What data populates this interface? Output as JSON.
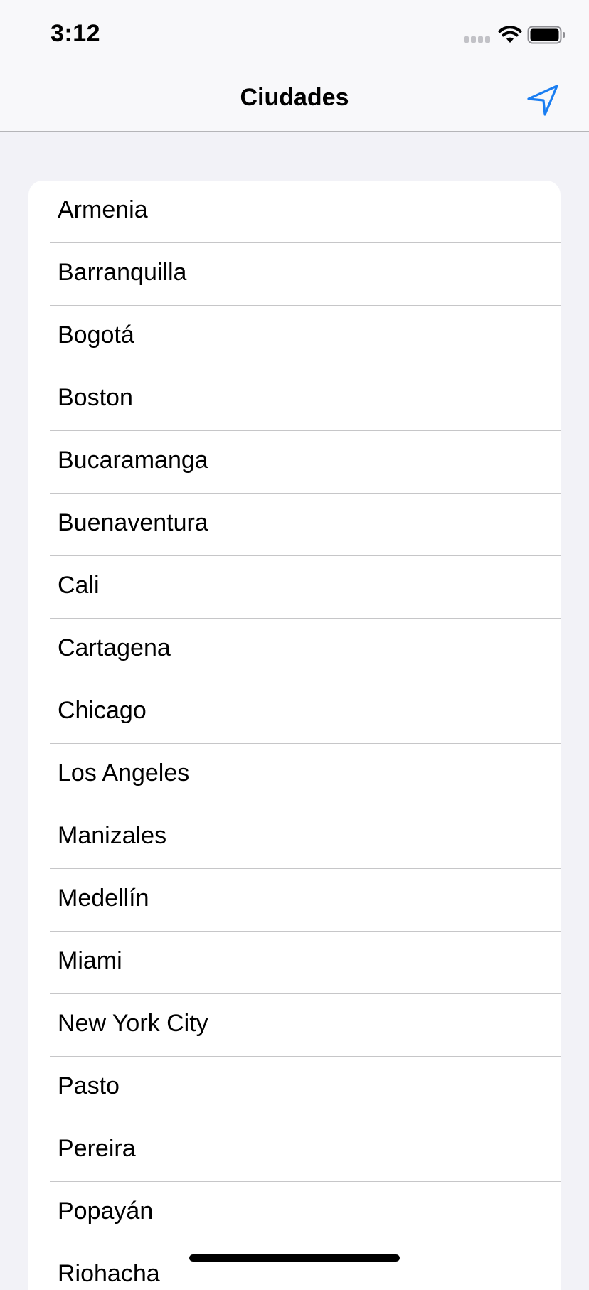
{
  "status_bar": {
    "time": "3:12",
    "signal_icon": "cellular-signal-icon",
    "wifi_icon": "wifi-icon",
    "battery_icon": "battery-icon"
  },
  "nav_bar": {
    "title": "Ciudades",
    "location_icon": "location-arrow-icon",
    "accent_color": "#1a7ef2"
  },
  "cities": [
    "Armenia",
    "Barranquilla",
    "Bogotá",
    "Boston",
    "Bucaramanga",
    "Buenaventura",
    "Cali",
    "Cartagena",
    "Chicago",
    "Los Angeles",
    "Manizales",
    "Medellín",
    "Miami",
    "New York City",
    "Pasto",
    "Pereira",
    "Popayán",
    "Riohacha"
  ],
  "colors": {
    "background": "#f2f2f7",
    "card": "#ffffff",
    "separator": "#c6c6c8"
  }
}
